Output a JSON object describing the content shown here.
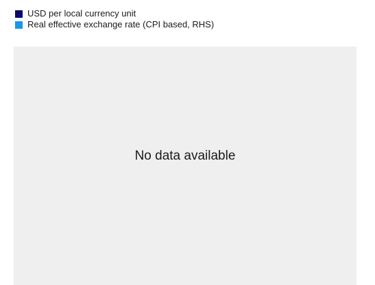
{
  "chart_data": {
    "type": "line",
    "title": "",
    "xlabel": "",
    "ylabel": "",
    "series": [
      {
        "name": "USD per local currency unit",
        "color": "#0b0a6b",
        "values": []
      },
      {
        "name": "Real effective exchange rate (CPI based, RHS)",
        "color": "#1a98e6",
        "values": []
      }
    ],
    "legend_position": "top-left",
    "grid": false
  },
  "message": "No data available"
}
